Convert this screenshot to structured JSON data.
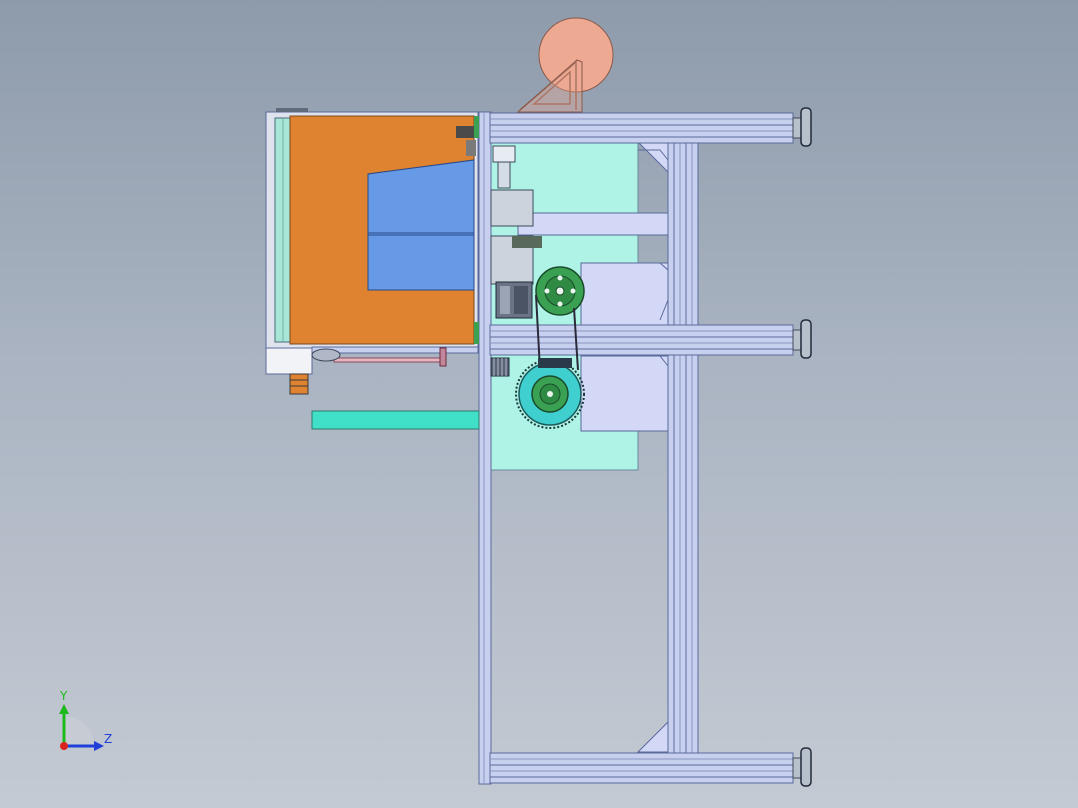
{
  "triad": {
    "y_label": "Y",
    "z_label": "Z",
    "colors": {
      "y": "#1db91d",
      "z": "#1f3fd8",
      "origin": "#d8241f"
    }
  },
  "colors": {
    "frame": "#c8d0f0",
    "frame_edge": "#5a6a9a",
    "panel_cyan": "#aef3e6",
    "panel_lavender": "#d3d8f7",
    "hopper_orange": "#e08331",
    "bin_blue": "#6699e6",
    "reel": "#eea992",
    "pulley_green": "#3aa052",
    "gear_teal": "#3fcfcf",
    "guide_rail": "#40e0c8",
    "foot": "#b8c0cc"
  }
}
